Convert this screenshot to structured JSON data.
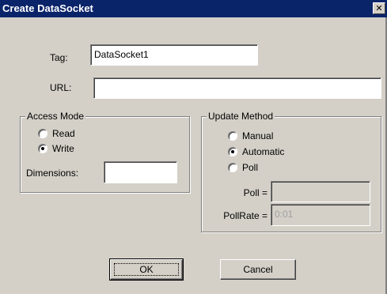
{
  "dialog": {
    "title": "Create DataSocket",
    "close_symbol": "✕"
  },
  "fields": {
    "tag_label": "Tag:",
    "tag_value": "DataSocket1",
    "url_label": "URL:",
    "url_value": ""
  },
  "access_mode": {
    "title": "Access Mode",
    "options": [
      {
        "label": "Read",
        "selected": false
      },
      {
        "label": "Write",
        "selected": true
      }
    ],
    "dimensions_label": "Dimensions:",
    "dimensions_value": ""
  },
  "update_method": {
    "title": "Update Method",
    "options": [
      {
        "label": "Manual",
        "selected": false
      },
      {
        "label": "Automatic",
        "selected": true
      },
      {
        "label": "Poll",
        "selected": false
      }
    ],
    "poll_label": "Poll =",
    "poll_value": "",
    "pollrate_label": "PollRate =",
    "pollrate_value": "0:01"
  },
  "buttons": {
    "ok_label": "OK",
    "cancel_label": "Cancel"
  }
}
